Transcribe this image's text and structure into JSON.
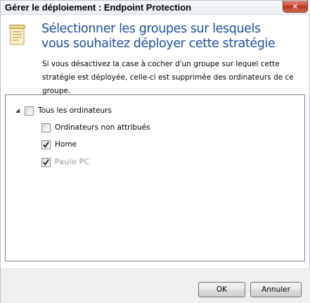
{
  "window": {
    "title": "Gérer le déploiement : Endpoint Protection",
    "close_glyph": "✕"
  },
  "header": {
    "icon": "policy-document-icon",
    "title_line1": "Sélectionner les groupes sur lesquels",
    "title_line2": "vous souhaitez déployer cette stratégie",
    "description_line1": "Si vous désactivez la case à cocher d'un groupe sur lequel cette",
    "description_line2": "stratégie est déployée, celle-ci est supprimée des ordinateurs de ce",
    "description_line3": "groupe."
  },
  "tree": {
    "root": {
      "label": "Tous les ordinateurs",
      "checked": false,
      "expanded": true
    },
    "children": [
      {
        "label": "Ordinateurs non attribués",
        "checked": false
      },
      {
        "label": "Home",
        "checked": true
      },
      {
        "label": "Paulo PC",
        "checked": true
      }
    ]
  },
  "buttons": {
    "ok": "OK",
    "cancel": "Annuler"
  },
  "colors": {
    "heading": "#1f4fa3",
    "close_button": "#c7432d"
  }
}
